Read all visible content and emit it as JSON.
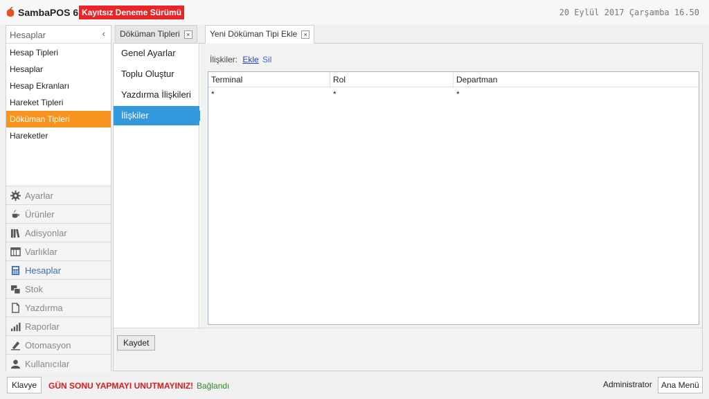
{
  "app": {
    "title": "SambaPOS 6",
    "trial_badge": "Kayıtsız Deneme Sürümü",
    "datetime": "20 Eylül 2017 Çarşamba 16.50"
  },
  "sidebar": {
    "header": "Hesaplar",
    "collapse_glyph": "‹",
    "items": [
      {
        "label": "Hesap Tipleri"
      },
      {
        "label": "Hesaplar"
      },
      {
        "label": "Hesap Ekranları"
      },
      {
        "label": "Hareket Tipleri"
      },
      {
        "label": "Döküman Tipleri",
        "active": true
      },
      {
        "label": "Hareketler"
      }
    ],
    "nav": [
      {
        "label": "Ayarlar",
        "icon": "gear-icon"
      },
      {
        "label": "Ürünler",
        "icon": "cup-icon"
      },
      {
        "label": "Adisyonlar",
        "icon": "books-icon"
      },
      {
        "label": "Varlıklar",
        "icon": "table-icon"
      },
      {
        "label": "Hesaplar",
        "icon": "calculator-icon",
        "active": true
      },
      {
        "label": "Stok",
        "icon": "boxes-icon"
      },
      {
        "label": "Yazdırma",
        "icon": "document-icon"
      },
      {
        "label": "Raporlar",
        "icon": "bar-chart-icon"
      },
      {
        "label": "Otomasyon",
        "icon": "pen-icon"
      },
      {
        "label": "Kullanıcılar",
        "icon": "user-icon"
      }
    ]
  },
  "tabs": [
    {
      "label": "Döküman Tipleri",
      "close": "×"
    },
    {
      "label": "Yeni Döküman Tipi Ekle",
      "close": "×",
      "active": true
    }
  ],
  "settings_nav": [
    {
      "label": "Genel Ayarlar"
    },
    {
      "label": "Toplu Oluştur"
    },
    {
      "label": "Yazdırma İlişkileri"
    },
    {
      "label": "İlişkiler",
      "active": true
    }
  ],
  "relations": {
    "label": "İlişkiler:",
    "add": "Ekle",
    "delete": "Sil",
    "columns": [
      "Terminal",
      "Rol",
      "Departman"
    ],
    "rows": [
      [
        "*",
        "*",
        "*"
      ]
    ]
  },
  "footer": {
    "save_label": "Kaydet"
  },
  "statusbar": {
    "keyboard": "Klavye",
    "warning": "GÜN SONU YAPMAYI UNUTMAYINIZ!",
    "connection": "Bağlandı",
    "user": "Administrator",
    "menu": "Ana Menü"
  },
  "colors": {
    "accent_orange": "#f7931e",
    "badge_red": "#e8262a",
    "selection_blue": "#3399dd",
    "warning_red": "#e01a1a",
    "connected_green": "#2e8b2e"
  }
}
